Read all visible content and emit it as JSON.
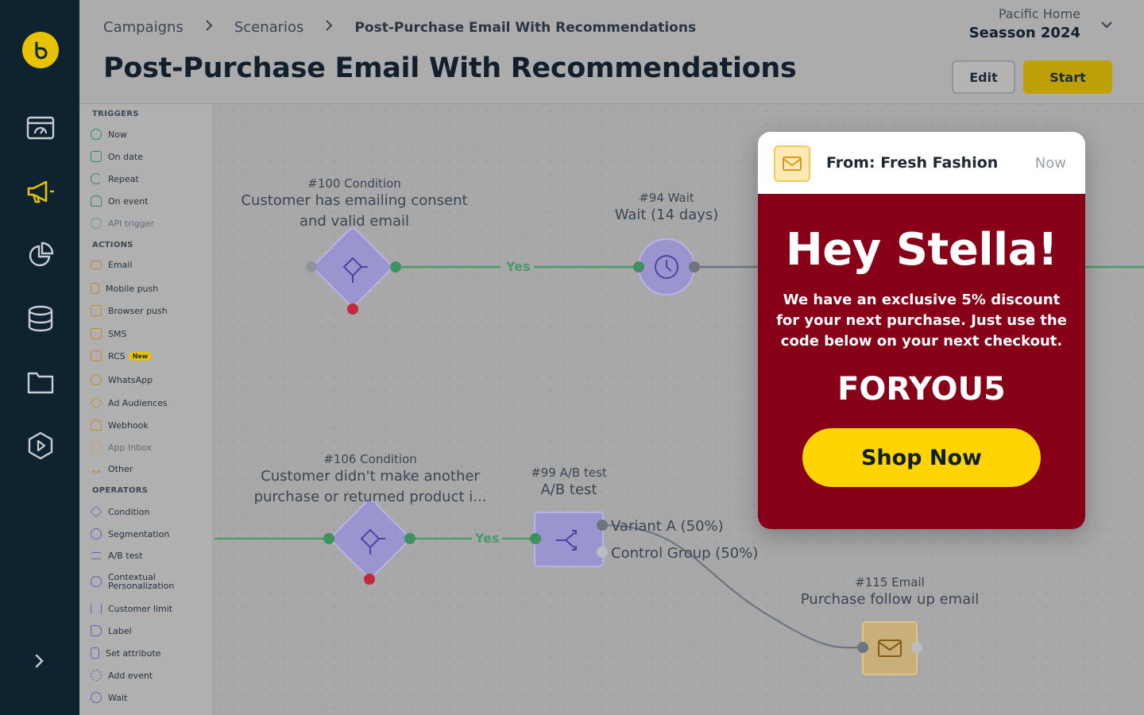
{
  "breadcrumb": {
    "items": [
      "Campaigns",
      "Scenarios"
    ],
    "current": "Post-Purchase Email With Recommendations"
  },
  "page_title": "Post-Purchase Email With Recommendations",
  "workspace": {
    "org": "Pacific Home",
    "name": "Seasson 2024"
  },
  "actions": {
    "edit": "Edit",
    "start": "Start"
  },
  "rail_icons": [
    "logo-icon",
    "dashboard-icon",
    "campaigns-icon",
    "analytics-icon",
    "data-icon",
    "assets-icon",
    "automation-icon",
    "expand-icon"
  ],
  "palette": {
    "sections": {
      "triggers": "TRIGGERS",
      "actions": "ACTIONS",
      "operators": "OPERATORS"
    },
    "triggers": [
      "Now",
      "On date",
      "Repeat",
      "On event",
      "API trigger"
    ],
    "actions": [
      "Email",
      "Mobile push",
      "Browser push",
      "SMS",
      "RCS",
      "WhatsApp",
      "Ad Audiences",
      "Webhook",
      "App Inbox",
      "Other"
    ],
    "operators": [
      "Condition",
      "Segmentation",
      "A/B test",
      "Contextual Personalization",
      "Customer limit",
      "Label",
      "Set attribute",
      "Add event",
      "Wait"
    ],
    "new_badge": "New"
  },
  "nodes": {
    "n100": {
      "id": "#100 Condition",
      "desc1": "Customer has emailing consent",
      "desc2": "and valid email"
    },
    "n94": {
      "id": "#94 Wait",
      "desc": "Wait (14 days)"
    },
    "n106": {
      "id": "#106 Condition",
      "desc1": "Customer didn't make another",
      "desc2": "purchase or returned product i..."
    },
    "n99": {
      "id": "#99 A/B test",
      "desc": "A/B test"
    },
    "n115": {
      "id": "#115 Email",
      "desc": "Purchase follow up email"
    }
  },
  "edges": {
    "yes1": "Yes",
    "yes2": "Yes",
    "variant_a": "Variant A (50%)",
    "control": "Control Group (50%)"
  },
  "email_preview": {
    "from": "From: Fresh Fashion",
    "time": "Now",
    "greeting": "Hey Stella!",
    "message": "We have an exclusive 5% discount for your next purchase. Just use the code below on your next checkout.",
    "code": "FORYOU5",
    "cta": "Shop Now",
    "colors": {
      "body": "#880018",
      "cta": "#ffd400"
    }
  },
  "colors": {
    "rail": "#0f2230",
    "accent": "#e6c200",
    "edge_yes": "#4a9a6a",
    "node": "#9b95cf"
  }
}
